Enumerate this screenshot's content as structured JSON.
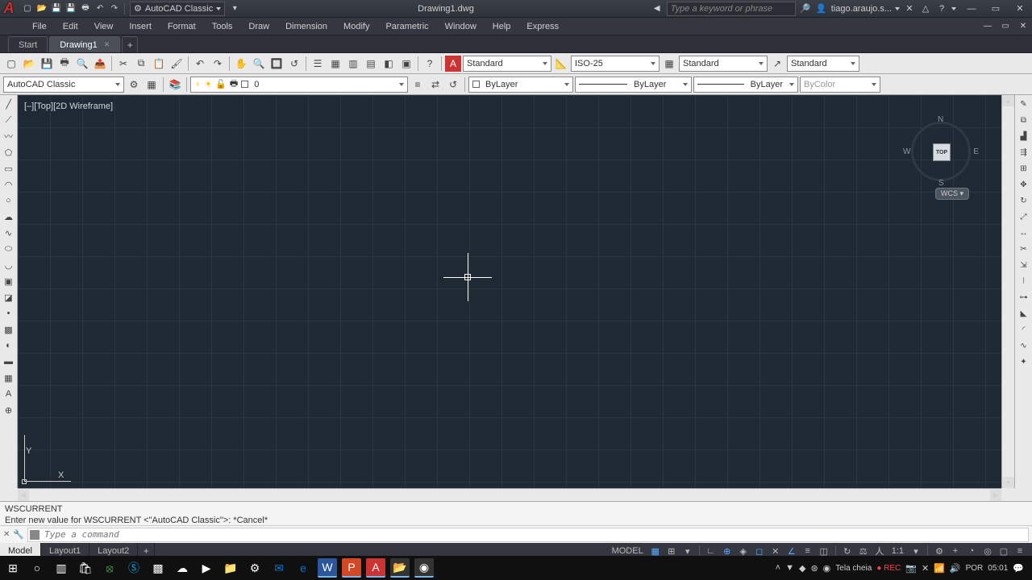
{
  "title": {
    "filename": "Drawing1.dwg",
    "workspace_label": "AutoCAD Classic"
  },
  "search": {
    "placeholder": "Type a keyword or phrase"
  },
  "user": {
    "name": "tiago.araujo.s..."
  },
  "menu": [
    "File",
    "Edit",
    "View",
    "Insert",
    "Format",
    "Tools",
    "Draw",
    "Dimension",
    "Modify",
    "Parametric",
    "Window",
    "Help",
    "Express"
  ],
  "file_tabs": {
    "start": "Start",
    "active": "Drawing1"
  },
  "toolbar1": {
    "text_style": "Standard",
    "dim_style": "ISO-25",
    "table_style": "Standard",
    "mleader_style": "Standard"
  },
  "toolbar2": {
    "workspace": "AutoCAD Classic",
    "layer_name": "0",
    "layer_select": "ByLayer",
    "linetype": "ByLayer",
    "lineweight": "ByLayer",
    "plot_style": "ByColor"
  },
  "viewport": {
    "label": "[–][Top][2D Wireframe]",
    "label_y": "Y",
    "label_x": "X"
  },
  "viewcube": {
    "top": "TOP",
    "n": "N",
    "s": "S",
    "e": "E",
    "w": "W",
    "wcs": "WCS"
  },
  "command": {
    "history_line1": "WSCURRENT",
    "history_line2": "Enter new value for WSCURRENT <\"AutoCAD Classic\">: *Cancel*",
    "prompt_placeholder": "Type a command"
  },
  "model_tabs": {
    "model": "Model",
    "l1": "Layout1",
    "l2": "Layout2"
  },
  "statusbar": {
    "model_label": "MODEL",
    "scale": "1:1",
    "rec": "REC"
  },
  "tray": {
    "fullscreen": "Tela cheia",
    "lang": "POR",
    "time": "05:01"
  }
}
